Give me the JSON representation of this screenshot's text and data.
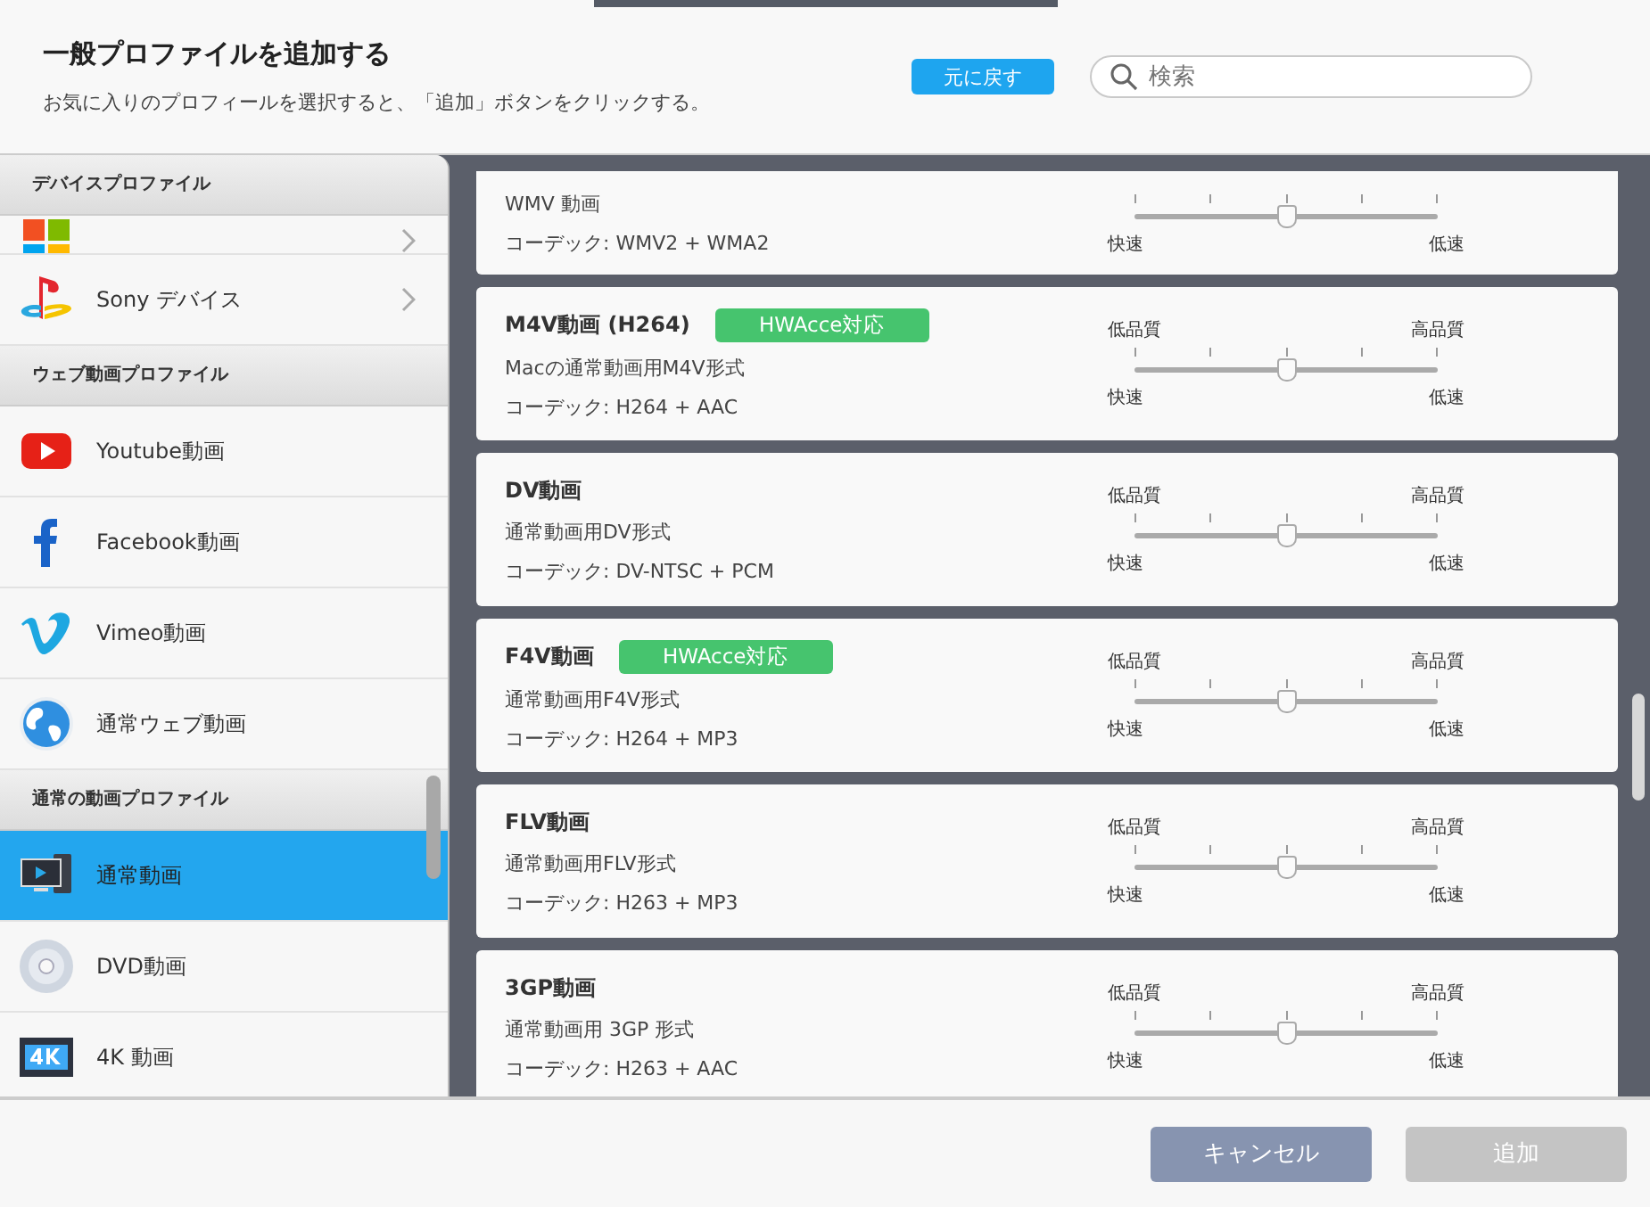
{
  "header": {
    "title": "一般プロファイルを追加する",
    "subtitle": "お気に入りのプロフィールを選択すると、「追加」ボタンをクリックする。",
    "reset_button": "元に戻す",
    "search": {
      "placeholder": "検索"
    }
  },
  "sidebar": {
    "groups": [
      {
        "title": "デバイスプロファイル",
        "items": [
          {
            "kind": "windows",
            "chevron": true,
            "selected": false
          },
          {
            "label": "Sony デバイス",
            "kind": "playstation",
            "chevron": true,
            "selected": false
          }
        ]
      },
      {
        "title": "ウェブ動画プロファイル",
        "items": [
          {
            "label": "Youtube動画",
            "kind": "youtube",
            "chevron": false,
            "selected": false
          },
          {
            "label": "Facebook動画",
            "kind": "facebook",
            "chevron": false,
            "selected": false
          },
          {
            "label": "Vimeo動画",
            "kind": "vimeo",
            "chevron": false,
            "selected": false
          },
          {
            "label": "通常ウェブ動画",
            "kind": "globe",
            "chevron": false,
            "selected": false
          }
        ]
      },
      {
        "title": "通常の動画プロファイル",
        "items": [
          {
            "label": "通常動画",
            "kind": "monitor",
            "chevron": false,
            "selected": true
          },
          {
            "label": "DVD動画",
            "kind": "disc",
            "chevron": false,
            "selected": false
          },
          {
            "label": "4K 動画",
            "kind": "film",
            "chevron": false,
            "selected": false
          }
        ]
      }
    ]
  },
  "cards": [
    {
      "description": "WMV 動画",
      "codec": "コーデック:  WMV2 + WMA2",
      "speed_labels": [
        "快速",
        "低速"
      ],
      "level": 0.5
    },
    {
      "title": "M4V動画 (H264)",
      "badge": "HWAcce対応",
      "description": "Macの通常動画用M4V形式",
      "codec": "コーデック:  H264 + AAC",
      "quality_labels": [
        "低品質",
        "高品質"
      ],
      "speed_labels": [
        "快速",
        "低速"
      ],
      "level": 0.5
    },
    {
      "title": "DV動画",
      "description": "通常動画用DV形式",
      "codec": "コーデック:  DV-NTSC + PCM",
      "quality_labels": [
        "低品質",
        "高品質"
      ],
      "speed_labels": [
        "快速",
        "低速"
      ],
      "level": 0.5
    },
    {
      "title": "F4V動画",
      "badge": "HWAcce対応",
      "description": "通常動画用F4V形式",
      "codec": "コーデック:  H264 + MP3",
      "quality_labels": [
        "低品質",
        "高品質"
      ],
      "speed_labels": [
        "快速",
        "低速"
      ],
      "level": 0.5
    },
    {
      "title": "FLV動画",
      "description": "通常動画用FLV形式",
      "codec": "コーデック:  H263 + MP3",
      "quality_labels": [
        "低品質",
        "高品質"
      ],
      "speed_labels": [
        "快速",
        "低速"
      ],
      "level": 0.5
    },
    {
      "title": "3GP動画",
      "description": "通常動画用 3GP 形式",
      "codec": "コーデック:  H263 + AAC",
      "quality_labels": [
        "低品質",
        "高品質"
      ],
      "speed_labels": [
        "快速",
        "低速"
      ],
      "level": 0.5
    }
  ],
  "footer": {
    "buttons": [
      {
        "label": "キャンセル",
        "disabled": false
      },
      {
        "label": "追加",
        "disabled": true
      }
    ]
  }
}
